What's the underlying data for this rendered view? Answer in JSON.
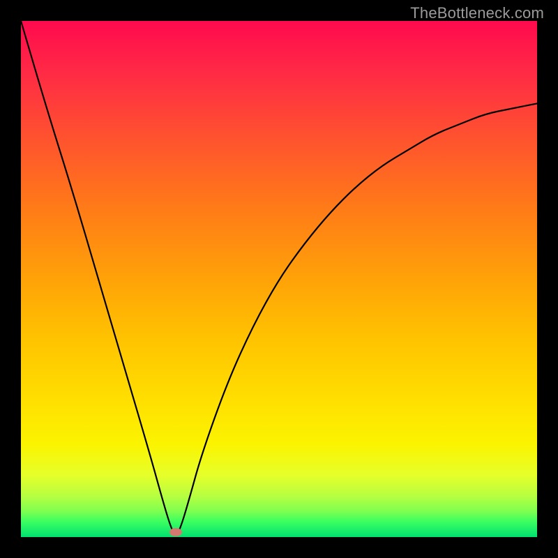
{
  "watermark": "TheBottleneck.com",
  "chart_data": {
    "type": "line",
    "title": "",
    "xlabel": "",
    "ylabel": "",
    "xlim": [
      0,
      100
    ],
    "ylim": [
      0,
      100
    ],
    "grid": false,
    "series": [
      {
        "name": "curve",
        "x": [
          0,
          5,
          10,
          15,
          20,
          25,
          27.5,
          29,
          30,
          31,
          32.5,
          35,
          40,
          45,
          50,
          55,
          60,
          65,
          70,
          75,
          80,
          85,
          90,
          95,
          100
        ],
        "values": [
          100,
          83,
          67,
          50,
          33,
          16,
          7,
          2,
          0,
          2,
          7,
          16,
          30,
          41,
          50,
          57,
          63,
          68,
          72,
          75,
          78,
          80,
          82,
          83,
          84
        ]
      }
    ],
    "marker": {
      "x": 30,
      "y": 1
    },
    "gradient_bands": [
      {
        "stop": 0,
        "color": "#ff0a4e"
      },
      {
        "stop": 50,
        "color": "#ffa208"
      },
      {
        "stop": 82,
        "color": "#fbf400"
      },
      {
        "stop": 100,
        "color": "#00e070"
      }
    ]
  }
}
